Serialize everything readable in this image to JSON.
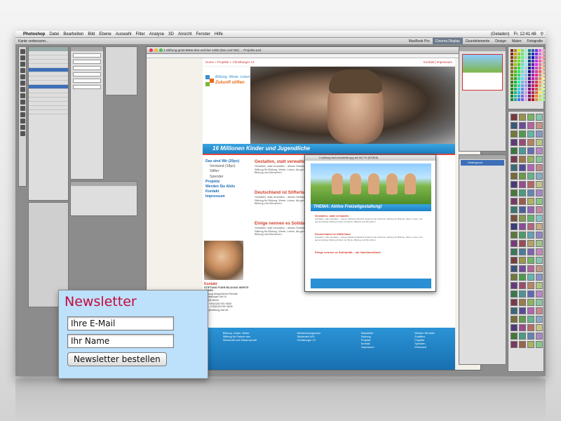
{
  "menubar": {
    "app": "Photoshop",
    "items": [
      "Datei",
      "Bearbeiten",
      "Bild",
      "Ebene",
      "Auswahl",
      "Filter",
      "Analyse",
      "3D",
      "Ansicht",
      "Fenster",
      "Hilfe"
    ],
    "status": "(Geladen)",
    "clock": "Fr. 12:41:48"
  },
  "optionsbar": {
    "left": "Kante verbessern...",
    "workspace": [
      "MacBook Pro",
      "Cinema Display",
      "Grundelemente",
      "Design",
      "Malen",
      "Fotografie"
    ],
    "active_workspace": "Cinema Display"
  },
  "document": {
    "title": "1-Stiftung-geist-Bette-das-und-bei-1396 (Das und Wir) ... Projekte.psd",
    "site": {
      "breadcrumb": "Home » Projekte » Christburger 13",
      "top_links": "Kontakt | Impressum",
      "logo_line": "Bildung. Werte. Leben.",
      "logo_tag": "Zukunft stiften",
      "banner": "16 Millionen Kinder und Jugendliche",
      "nav": [
        {
          "label": "Das sind Wir (20px)",
          "type": "item"
        },
        {
          "label": "Vorstand (18px)",
          "type": "sub"
        },
        {
          "label": "Stifter",
          "type": "sub"
        },
        {
          "label": "Spender",
          "type": "sub"
        },
        {
          "label": "Projekte",
          "type": "item"
        },
        {
          "label": "Werden Sie Aktiv",
          "type": "item"
        },
        {
          "label": "Kontakt",
          "type": "item"
        },
        {
          "label": "Impressum",
          "type": "item"
        }
      ],
      "headings": [
        "Gestalten, statt verwalten",
        "Deutschland ist Stifterland",
        "Einige nennen es Solidarität"
      ],
      "body_text": "Gestalten, statt verwalten – dieses Selbstverständnis bestimmt die Arbeit der Stiftung für Bildung. Werte. Leben. Als gemeinnützige Stiftung fördern wir Werte, Bildung und Menschen.",
      "contact": {
        "heading": "Kontakt",
        "org": "STIFTUNG FUER BILDUNG WERTE LEBEN",
        "lines": [
          "Stiftung bürgerlichen Rechts",
          "Christburger Str.14",
          "10405 Berlin",
          "Tel: +49(0)30/760 9633",
          "Fax: +49(0)30/760 9606",
          "info@stiftung-bwl.de"
        ]
      },
      "footer_cols": [
        [
          "Bildung. Leben. Werte",
          "Stiftung für Partner aus",
          "Wirtschaft und Wissenschaft"
        ],
        [
          "Mentorenprogramm",
          "Studenten-WG",
          "Christburger 13"
        ],
        [
          "Newsletter",
          "Satzung",
          "Projekte",
          "Kontakt",
          "Impressum"
        ],
        [
          "Werden Sie Aktiv",
          "Zustiften",
          "Projekte",
          "Spenden",
          "Ehrenamt"
        ]
      ]
    }
  },
  "newsletter_window": {
    "title": "2-stiftung-bwl-newsletter.jpg bei 66,7% (RGB/8)",
    "banner": "THEMA: Aktive Freizeitgestaltung!",
    "headings": [
      "Gestalten, statt verwalten",
      "Deutschland ist Stifterland",
      "Einige nennen es Solidarität – wir Nachbarstände"
    ]
  },
  "layers_panel": {
    "layer": "Hintergrund"
  },
  "newsletter": {
    "title": "Newsletter",
    "email_placeholder": "Ihre E-Mail",
    "name_placeholder": "Ihr Name",
    "button": "Newsletter bestellen"
  },
  "colors": {
    "accent_red": "#c40a3a",
    "site_blue": "#1c7fc4",
    "box_blue": "#bde0fb"
  }
}
